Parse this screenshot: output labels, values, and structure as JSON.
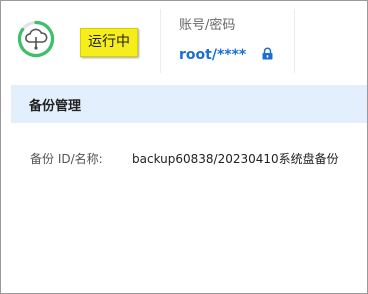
{
  "status": {
    "label": "运行中",
    "icon": "cloud-icon",
    "ring_color": "#3dbf6b",
    "badge_color": "#f6ee1c"
  },
  "credentials": {
    "label": "账号/密码",
    "value": "root/****",
    "icon": "lock-icon",
    "accent": "#1b6fd1"
  },
  "section": {
    "title": "备份管理",
    "header_color": "#e3effc"
  },
  "backup": {
    "label": "备份 ID/名称:",
    "value": "backup60838/20230410系统盘备份"
  }
}
